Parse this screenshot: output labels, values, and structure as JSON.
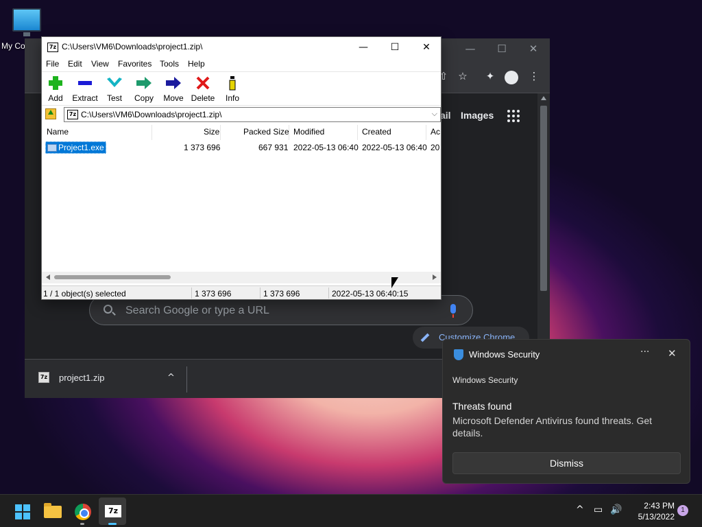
{
  "desktop": {
    "icon_label": "My Co"
  },
  "chrome": {
    "minimize": "—",
    "maximize": "☐",
    "close": "✕",
    "ntp_link_partial": "ail",
    "ntp_images": "Images",
    "search_placeholder": "Search Google or type a URL",
    "customize_label": "Customize Chrome",
    "download": {
      "filename": "project1.zip",
      "chevron": "^"
    }
  },
  "zip_window": {
    "title": "C:\\Users\\VM6\\Downloads\\project1.zip\\",
    "logo_text": "7z",
    "minimize": "—",
    "maximize": "☐",
    "close": "✕",
    "menu": [
      "File",
      "Edit",
      "View",
      "Favorites",
      "Tools",
      "Help"
    ],
    "toolbar": [
      {
        "label": "Add",
        "icon": "plus-icon",
        "color": "#1db31d"
      },
      {
        "label": "Extract",
        "icon": "minus-icon",
        "color": "#1b1bd6"
      },
      {
        "label": "Test",
        "icon": "test-chevron-icon",
        "color": "#14b4c4"
      },
      {
        "label": "Copy",
        "icon": "copy-arrow-icon",
        "color": "#1d9a6c"
      },
      {
        "label": "Move",
        "icon": "move-arrow-icon",
        "color": "#1b1b9e"
      },
      {
        "label": "Delete",
        "icon": "delete-x-icon",
        "color": "#e01a1a"
      },
      {
        "label": "Info",
        "icon": "info-icon",
        "color": "#c8b400"
      }
    ],
    "address": "C:\\Users\\VM6\\Downloads\\project1.zip\\",
    "columns": [
      "Name",
      "Size",
      "Packed Size",
      "Modified",
      "Created",
      "Ac"
    ],
    "rows": [
      {
        "name": "Project1.exe",
        "size": "1 373 696",
        "packed": "667 931",
        "modified": "2022-05-13 06:40",
        "created": "2022-05-13 06:40",
        "accessed": "20"
      }
    ],
    "status": {
      "selected": "1 / 1 object(s) selected",
      "size": "1 373 696",
      "packed": "1 373 696",
      "date": "2022-05-13 06:40:15"
    }
  },
  "notification": {
    "app": "Windows Security",
    "more": "···",
    "close": "✕",
    "source": "Windows Security",
    "heading": "Threats found",
    "body": "Microsoft Defender Antivirus found threats. Get details.",
    "dismiss": "Dismiss"
  },
  "taskbar": {
    "time": "2:43 PM",
    "date": "5/13/2022",
    "notification_count": "1",
    "sz_label": "7z",
    "tray_chevron": "^",
    "tray_volume": "🔊"
  }
}
